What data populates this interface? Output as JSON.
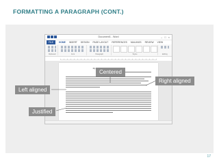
{
  "slide": {
    "title": "FORMATTING A PARAGRAPH (CONT.)",
    "page_number": "17"
  },
  "word": {
    "window_title": "Document1 - Word",
    "tabs": [
      "FILE",
      "HOME",
      "INSERT",
      "DESIGN",
      "PAGE LAYOUT",
      "REFERENCES",
      "MAILINGS",
      "REVIEW",
      "VIEW"
    ],
    "active_tab": "HOME",
    "ribbon_groups": [
      "Clipboard",
      "Font",
      "Paragraph",
      "Styles",
      "Editing"
    ],
    "doc_heading": "My Adaptation for Word Document"
  },
  "callouts": {
    "centered": "Centered",
    "right_aligned": "Right aligned",
    "left_aligned": "Left aligned",
    "justified": "Justified"
  },
  "colors": {
    "title": "#2e7d86",
    "callout_bg": "#8c8c8c",
    "panel_bg": "#eeeeee",
    "word_blue": "#2b579a"
  }
}
